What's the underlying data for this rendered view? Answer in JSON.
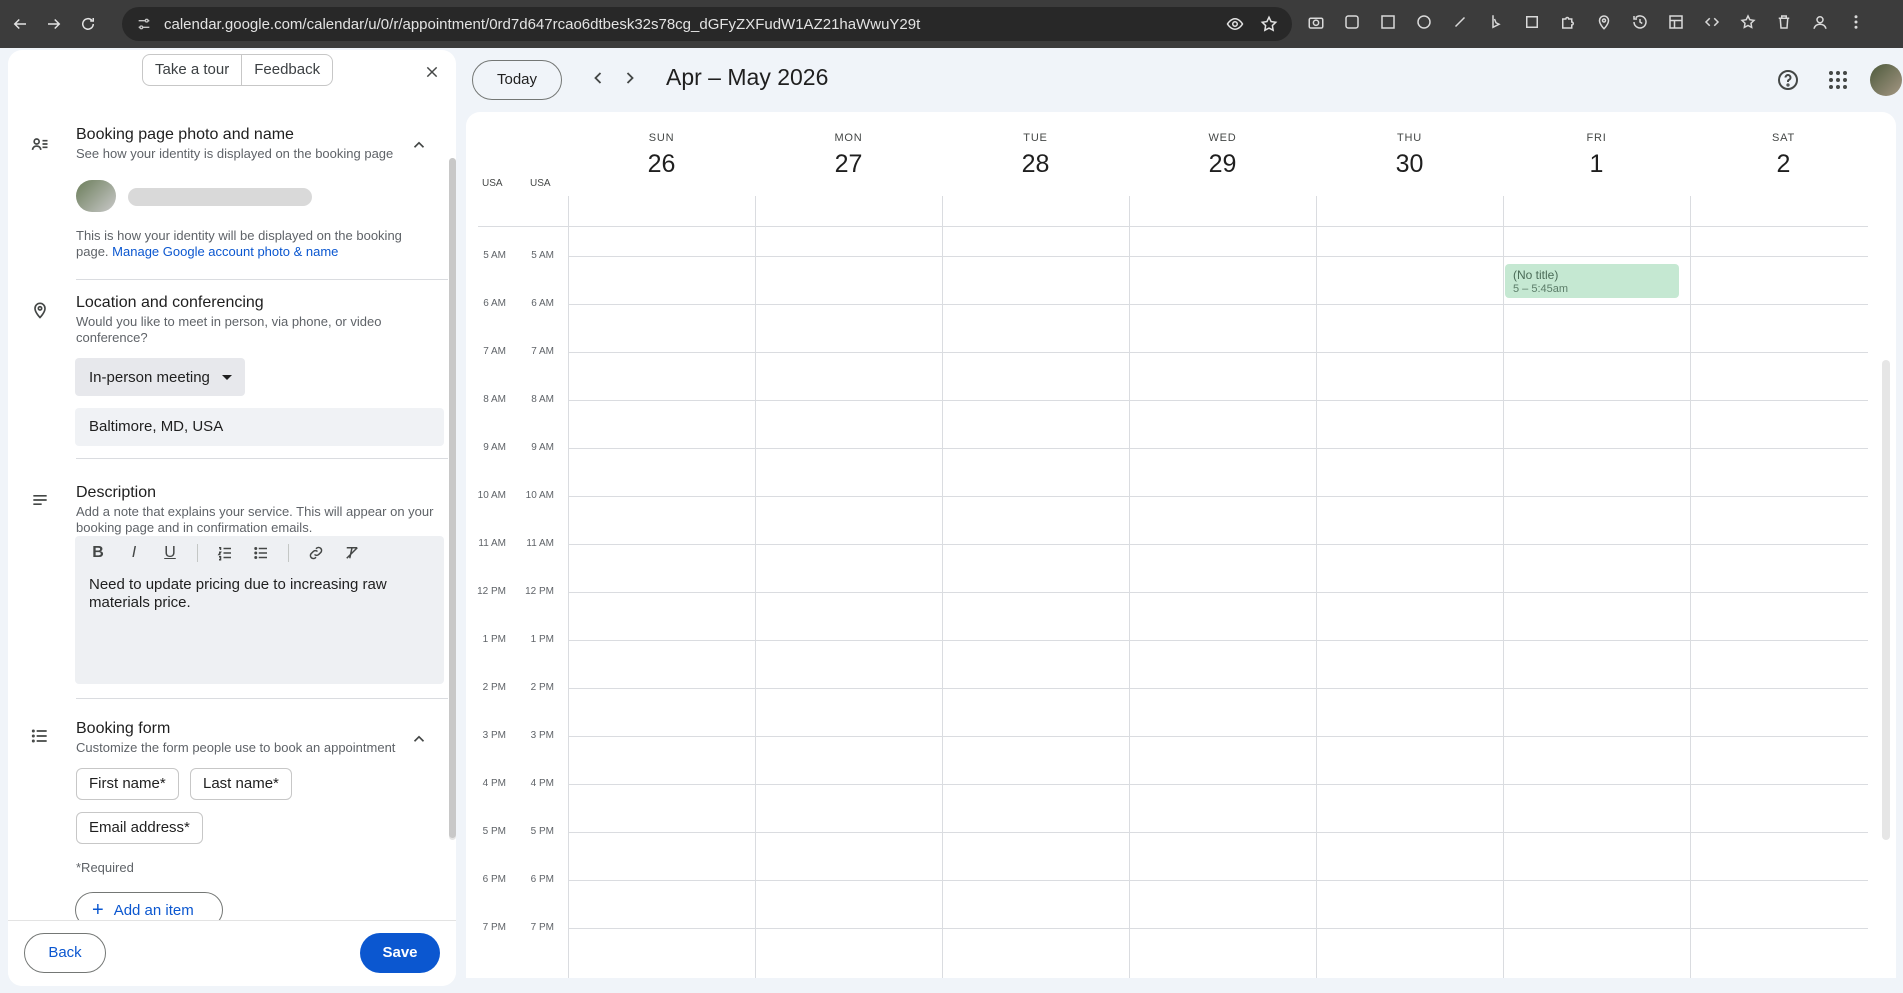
{
  "browser": {
    "url": "calendar.google.com/calendar/u/0/r/appointment/0rd7d647rcao6dtbesk32s78cg_dGFyZXFudW1AZ21haWwuY29t"
  },
  "panel": {
    "tour_label": "Take a tour",
    "feedback_label": "Feedback",
    "sections": {
      "photo": {
        "title": "Booking page photo and name",
        "subtitle": "See how your identity is displayed on the booking page",
        "note": "This is how your identity will be displayed on the booking page.",
        "link": "Manage Google account photo & name"
      },
      "location": {
        "title": "Location and conferencing",
        "subtitle": "Would you like to meet in person, via phone, or video conference?",
        "meeting_type": "In-person meeting",
        "address": "Baltimore, MD, USA"
      },
      "description": {
        "title": "Description",
        "subtitle": "Add a note that explains your service. This will appear on your booking page and in confirmation emails.",
        "bold": "B",
        "italic": "I",
        "underline": "U",
        "text": "Need to update pricing due to increasing raw materials price."
      },
      "booking_form": {
        "title": "Booking form",
        "subtitle": "Customize the form people use to book an appointment",
        "fields": [
          "First name*",
          "Last name*",
          "Email address*"
        ],
        "required_note": "*Required",
        "add_item": "Add an item"
      }
    },
    "back_label": "Back",
    "save_label": "Save"
  },
  "calendar": {
    "today_label": "Today",
    "date_range": "Apr – May 2026",
    "timezones": [
      "USA",
      "USA"
    ],
    "days": [
      {
        "name": "SUN",
        "num": "26"
      },
      {
        "name": "MON",
        "num": "27"
      },
      {
        "name": "TUE",
        "num": "28"
      },
      {
        "name": "WED",
        "num": "29"
      },
      {
        "name": "THU",
        "num": "30"
      },
      {
        "name": "FRI",
        "num": "1"
      },
      {
        "name": "SAT",
        "num": "2"
      }
    ],
    "hours": [
      "5 AM",
      "6 AM",
      "7 AM",
      "8 AM",
      "9 AM",
      "10 AM",
      "11 AM",
      "12 PM",
      "1 PM",
      "2 PM",
      "3 PM",
      "4 PM",
      "5 PM",
      "6 PM",
      "7 PM"
    ],
    "event": {
      "title": "(No title)",
      "time": "5 – 5:45am"
    }
  }
}
